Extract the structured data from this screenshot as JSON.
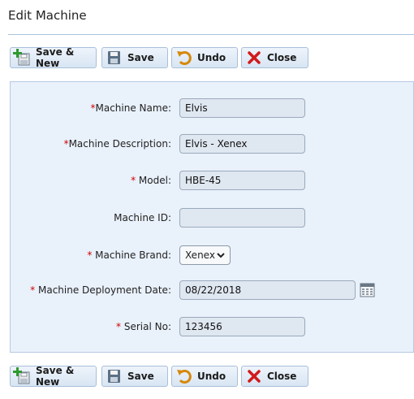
{
  "page": {
    "title": "Edit Machine"
  },
  "toolbar": {
    "save_new": "Save & New",
    "save": "Save",
    "undo": "Undo",
    "close": "Close"
  },
  "form": {
    "required_marker": "*",
    "machine_name": {
      "label": "Machine Name:",
      "value": "Elvis",
      "required": true
    },
    "machine_description": {
      "label": "Machine Description:",
      "value": "Elvis - Xenex",
      "required": true
    },
    "model": {
      "label": "Model:",
      "value": "HBE-45",
      "required": true
    },
    "machine_id": {
      "label": "Machine ID:",
      "value": "",
      "required": false
    },
    "machine_brand": {
      "label": "Machine Brand:",
      "selected": "Xenex",
      "required": true
    },
    "deployment_date": {
      "label": "Machine Deployment Date:",
      "value": "08/22/2018",
      "required": true
    },
    "serial_no": {
      "label": "Serial No:",
      "value": "123456",
      "required": true
    }
  },
  "colors": {
    "accent_border": "#a8bfd9",
    "panel_bg": "#e9f1fb",
    "required": "#d10000",
    "close_icon": "#d11a1a",
    "undo_icon": "#d6880a",
    "add_icon": "#2f9a2f"
  }
}
